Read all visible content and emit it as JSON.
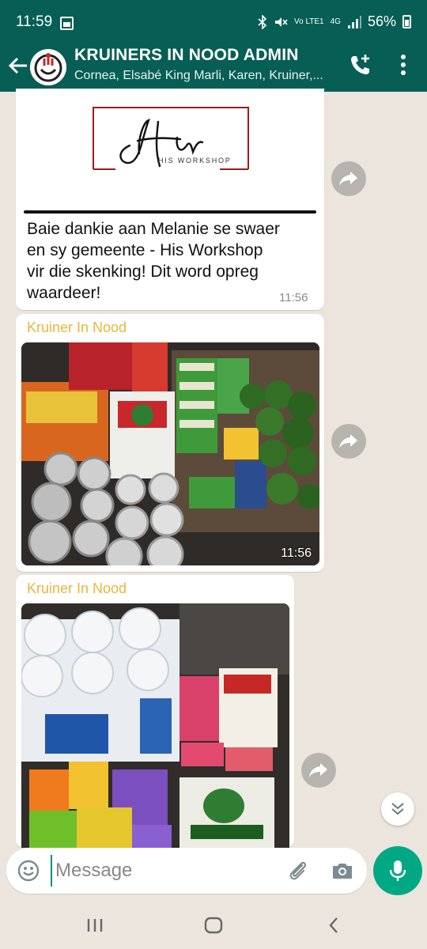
{
  "status_bar": {
    "time": "11:59",
    "signal_label": "Vo LTE1",
    "network_type": "4G",
    "battery": "56%"
  },
  "header": {
    "title": "KRUINERS  IN NOOD ADMIN",
    "subtitle": "Cornea, Elsabé King Marli, Karen, Kruiner,..."
  },
  "messages": [
    {
      "logo_text": "His Workshop",
      "logo_subtext": "HIS WORKSHOP",
      "text": "Baie dankie aan Melanie se swaer\nen sy gemeente - His Workshop\nvir die skenking! Dit word opreg\nwaardeer!",
      "time": "11:56"
    },
    {
      "sender": "Kruiner In Nood",
      "image": "photo of food donations",
      "time": "11:56"
    },
    {
      "sender": "Kruiner In Nood",
      "image": "photo of toilet paper and groceries"
    }
  ],
  "composer": {
    "placeholder": "Message"
  },
  "colors": {
    "header": "#075e54",
    "accent": "#00a884",
    "sender": "#e8b63c",
    "chat_bg": "#ece5dd"
  },
  "icons": [
    "back-arrow-icon",
    "group-avatar",
    "add-call-icon",
    "more-vert-icon",
    "forward-icon",
    "chevron-down-icon",
    "emoji-icon",
    "attach-icon",
    "camera-icon",
    "mic-icon",
    "recents-icon",
    "home-icon",
    "back-nav-icon"
  ]
}
